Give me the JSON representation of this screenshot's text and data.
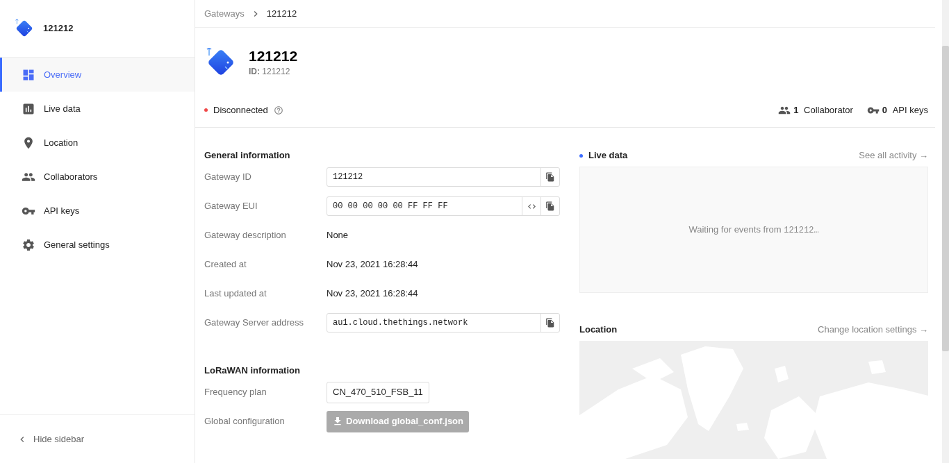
{
  "sidebar": {
    "title": "121212",
    "items": [
      {
        "label": "Overview",
        "kind": "dashboard",
        "selected": true
      },
      {
        "label": "Live data",
        "kind": "chart",
        "selected": false
      },
      {
        "label": "Location",
        "kind": "place",
        "selected": false
      },
      {
        "label": "Collaborators",
        "kind": "people",
        "selected": false
      },
      {
        "label": "API keys",
        "kind": "key",
        "selected": false
      },
      {
        "label": "General settings",
        "kind": "settings",
        "selected": false
      }
    ],
    "hide_label": "Hide sidebar"
  },
  "breadcrumbs": [
    {
      "label": "Gateways",
      "current": false
    },
    {
      "label": "121212",
      "current": true
    }
  ],
  "header": {
    "title": "121212",
    "id_label": "ID:",
    "id_value": "121212"
  },
  "status": {
    "label": "Disconnected",
    "connected": false
  },
  "counts": [
    {
      "kind": "people",
      "count": "1",
      "label": "Collaborator"
    },
    {
      "kind": "key",
      "count": "0",
      "label": "API keys"
    }
  ],
  "general": {
    "title": "General information",
    "rows": [
      {
        "kind": "field",
        "label": "Gateway ID",
        "value": "121212",
        "toggle": false,
        "copy": true
      },
      {
        "kind": "field",
        "label": "Gateway EUI",
        "value": "00 00 00 00 00 FF FF FF",
        "toggle": true,
        "copy": true
      },
      {
        "kind": "text",
        "label": "Gateway description",
        "value": "None"
      },
      {
        "kind": "text",
        "label": "Created at",
        "value": "Nov 23, 2021 16:28:44"
      },
      {
        "kind": "text",
        "label": "Last updated at",
        "value": "Nov 23, 2021 16:28:44"
      },
      {
        "kind": "field",
        "label": "Gateway Server address",
        "value": "au1.cloud.thethings.network",
        "toggle": false,
        "copy": true
      }
    ]
  },
  "lorawan": {
    "title": "LoRaWAN information",
    "rows": [
      {
        "kind": "tag",
        "label": "Frequency plan",
        "value": "CN_470_510_FSB_11"
      },
      {
        "kind": "download",
        "label": "Global configuration",
        "value": "Download global_conf.json",
        "disabled": true
      }
    ]
  },
  "live_data": {
    "title": "Live data",
    "link": "See all activity →",
    "message": "Waiting for events from",
    "target": "121212…"
  },
  "location": {
    "title": "Location",
    "link": "Change location settings →"
  }
}
